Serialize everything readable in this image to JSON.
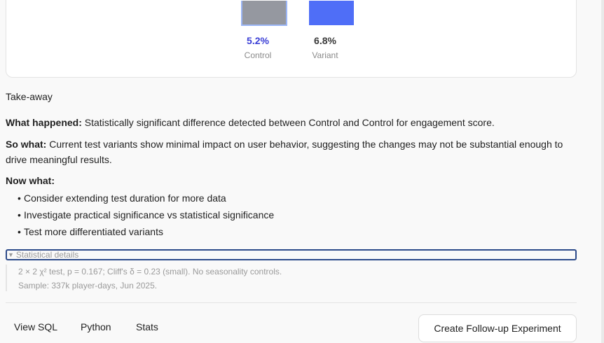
{
  "chart_data": {
    "type": "bar",
    "categories": [
      "Control",
      "Variant"
    ],
    "values": [
      5.2,
      6.8
    ],
    "value_labels": [
      "5.2%",
      "6.8%"
    ],
    "colors": [
      "#9598a0",
      "#4f6ef7"
    ],
    "value_label_colors": [
      "#3b3fd6",
      "#3a3a3a"
    ]
  },
  "takeaway": {
    "heading": "Take-away",
    "what_happened_label": "What happened:",
    "what_happened_text": " Statistically significant difference detected between Control and Control for engagement score.",
    "so_what_label": "So what:",
    "so_what_text": " Current test variants show minimal impact on user behavior, suggesting the changes may not be substantial enough to drive meaningful results.",
    "now_what_label": "Now what:",
    "now_what_items": [
      "Consider extending test duration for more data",
      "Investigate practical significance vs statistical significance",
      "Test more differentiated variants"
    ]
  },
  "details": {
    "summary": "Statistical details",
    "line1": "2 × 2 χ² test, p = 0.167; Cliff's δ = 0.23 (small). No seasonality controls.",
    "line2": "Sample: 337k player-days, Jun 2025."
  },
  "footer": {
    "tabs": [
      "View SQL",
      "Python",
      "Stats"
    ],
    "cta_label": "Create Follow-up Experiment"
  }
}
